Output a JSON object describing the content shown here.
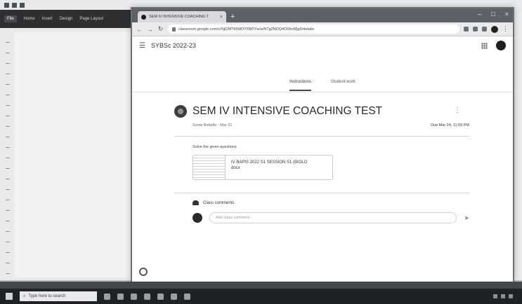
{
  "browser": {
    "tab_title": "SEM IV INTENSIVE COACHING T",
    "tab_close": "×",
    "new_tab": "+",
    "url": "classroom.google.com/c/NjI2MTk5MDY5NDYw/a/NTg2NDQ4ODkxMjg5/details",
    "window_controls": [
      "–",
      "□",
      "×"
    ]
  },
  "classroom": {
    "class_name": "SYBSc 2022-23",
    "avatar_letter": "",
    "tabs": [
      {
        "label": "Instructions",
        "active": true
      },
      {
        "label": "Student work",
        "active": false
      }
    ],
    "post": {
      "title": "SEM IV INTENSIVE COACHING TEST",
      "teacher_date": "Sonia Rebello · Mar 21",
      "due": "Due Mar 24, 11:59 PM",
      "instructions": "Solve the given questions",
      "attachment_line1": "IV BAPIS 2022 S1 SESSION S1 (BIOLO",
      "attachment_line2": "docx",
      "comments_label": "Class comments",
      "comment_placeholder": "Add class comment..."
    }
  },
  "taskbar": {
    "search_placeholder": "Type here to search",
    "time": "",
    "date": ""
  },
  "background_app": {
    "ribbon": [
      "File",
      "Home",
      "Insert",
      "Design",
      "Page Layout"
    ]
  }
}
